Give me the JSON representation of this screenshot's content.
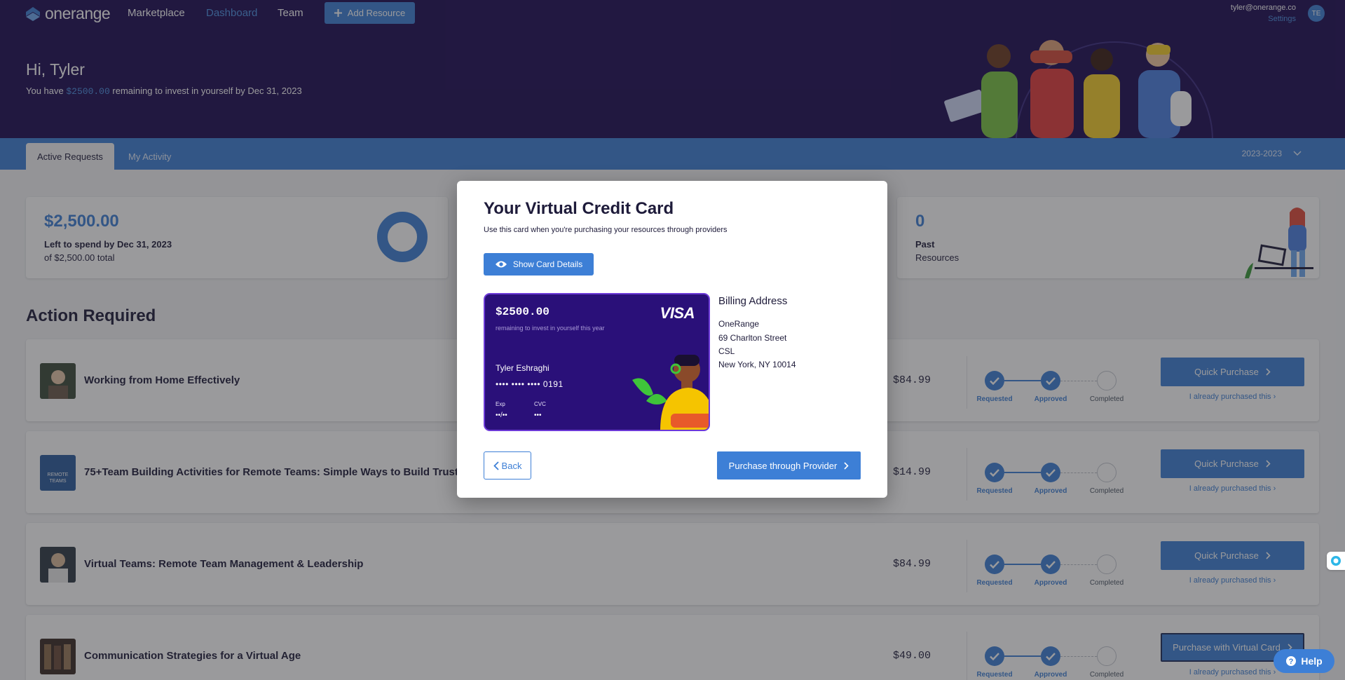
{
  "header": {
    "logo_text": "onerange",
    "nav": [
      "Marketplace",
      "Dashboard",
      "Team"
    ],
    "active_nav": "Dashboard",
    "add_resource_label": "Add Resource",
    "user_email": "tyler@onerange.co",
    "settings_label": "Settings",
    "avatar_initials": "TE",
    "greeting": "Hi, Tyler",
    "sub_prefix": "You have",
    "sub_amount": "$2500.00",
    "sub_suffix": "remaining to invest in yourself by Dec 31, 2023"
  },
  "tabs": {
    "items": [
      "Active Requests",
      "My Activity"
    ],
    "active": "Active Requests",
    "year": "2023-2023"
  },
  "summary": {
    "left_amount": "$2,500.00",
    "left_label": "Left to spend by Dec 31, 2023",
    "left_total": "of $2,500.00 total",
    "past_count": "0",
    "past_label": "Past",
    "past_sub": "Resources"
  },
  "action_required": {
    "title": "Action Required",
    "step_labels": [
      "Requested",
      "Approved",
      "Completed"
    ],
    "already_label": "I already purchased this",
    "rows": [
      {
        "title": "Working from Home Effectively",
        "price": "$84.99",
        "button": "Quick Purchase"
      },
      {
        "title": "75+Team Building Activities for Remote Teams: Simple Ways to Build Trust, St",
        "price": "$14.99",
        "button": "Quick Purchase",
        "thumb_text": [
          "REMOTE",
          "TEAMS"
        ]
      },
      {
        "title": "Virtual Teams: Remote Team Management & Leadership",
        "price": "$84.99",
        "button": "Quick Purchase"
      },
      {
        "title": "Communication Strategies for a Virtual Age",
        "price": "$49.00",
        "button": "Purchase with Virtual Card"
      }
    ]
  },
  "modal": {
    "title": "Your Virtual Credit Card",
    "subtitle": "Use this card when you're purchasing your resources through providers",
    "show_details_label": "Show Card Details",
    "card": {
      "amount": "$2500.00",
      "remaining": "remaining to invest in yourself this year",
      "brand": "VISA",
      "holder": "Tyler Eshraghi",
      "number_masked": "•••• •••• •••• 0191",
      "exp_label": "Exp",
      "exp_value": "••/••",
      "cvc_label": "CVC",
      "cvc_value": "•••"
    },
    "billing": {
      "title": "Billing Address",
      "lines": [
        "OneRange",
        "69 Charlton Street",
        "CSL",
        "New York, NY 10014"
      ]
    },
    "back_label": "Back",
    "purchase_label": "Purchase through Provider"
  },
  "help_label": "Help",
  "colors": {
    "brand_dark": "#1c0a52",
    "accent": "#3d7fd6",
    "link": "#4a90e2"
  }
}
